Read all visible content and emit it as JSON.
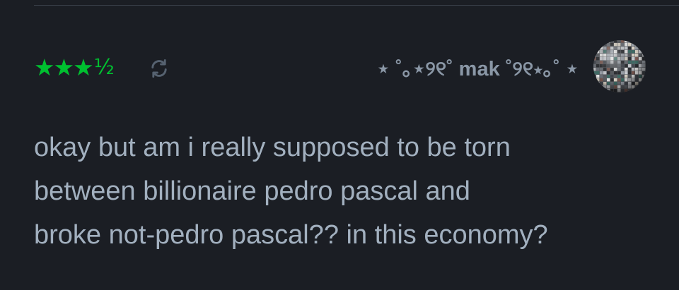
{
  "review": {
    "rating": {
      "stars": "★★★",
      "half": "½",
      "value": 3.5,
      "max": 5,
      "color": "#00c030"
    },
    "rewatch_icon": "rewatch-icon",
    "username": "⋆ ˚｡⋆୨୧˚ mak ˚୨୧⋆｡˚ ⋆",
    "avatar_icon": "disco-ball-avatar",
    "text_lines": [
      "okay but am i really supposed to be torn",
      "between billionaire pedro pascal and",
      "broke not-pedro pascal?? in this economy?"
    ]
  },
  "colors": {
    "background": "#1b1e24",
    "text": "#a2b0bf",
    "username": "#8a97a6",
    "divider": "#3a404a"
  }
}
